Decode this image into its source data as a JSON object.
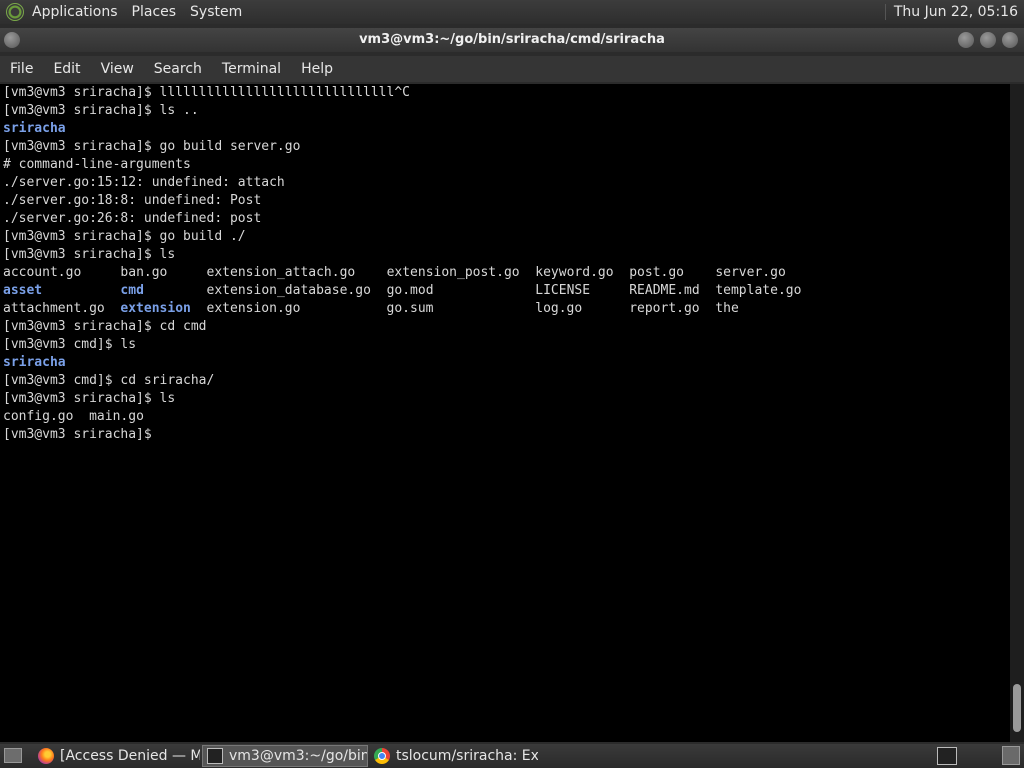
{
  "top_panel": {
    "menus": [
      "Applications",
      "Places",
      "System"
    ],
    "clock": "Thu Jun 22, 05:16"
  },
  "window": {
    "title": "vm3@vm3:~/go/bin/sriracha/cmd/sriracha"
  },
  "menubar": {
    "items": [
      "File",
      "Edit",
      "View",
      "Search",
      "Terminal",
      "Help"
    ]
  },
  "terminal": {
    "lines": [
      "[vm3@vm3 sriracha]$ llllllllllllllllllllllllllllll^C",
      "[vm3@vm3 sriracha]$ ls ..",
      "sriracha",
      "[vm3@vm3 sriracha]$ go build server.go",
      "# command-line-arguments",
      "./server.go:15:12: undefined: attach",
      "./server.go:18:8: undefined: Post",
      "./server.go:26:8: undefined: post",
      "[vm3@vm3 sriracha]$ go build ./",
      "[vm3@vm3 sriracha]$ ls",
      "account.go     ban.go     extension_attach.go    extension_post.go  keyword.go  post.go    server.go",
      "asset          cmd        extension_database.go  go.mod             LICENSE     README.md  template.go",
      "attachment.go  extension  extension.go           go.sum             log.go      report.go  the",
      "[vm3@vm3 sriracha]$ cd cmd",
      "[vm3@vm3 cmd]$ ls",
      "sriracha",
      "[vm3@vm3 cmd]$ cd sriracha/",
      "[vm3@vm3 sriracha]$ ls",
      "config.go  main.go",
      "[vm3@vm3 sriracha]$"
    ],
    "directory_names": [
      "sriracha",
      "asset",
      "cmd",
      "extension"
    ]
  },
  "taskbar": {
    "tasks": [
      {
        "label": "[Access Denied — M...",
        "icon": "firefox-icon"
      },
      {
        "label": "vm3@vm3:~/go/bin...",
        "icon": "terminal-icon"
      },
      {
        "label": "tslocum/sriracha: Ex...",
        "icon": "chrome-icon"
      }
    ]
  },
  "colors": {
    "directory": "#7aa0e8",
    "terminal_bg": "#000000",
    "terminal_fg": "#d8d8d8"
  }
}
